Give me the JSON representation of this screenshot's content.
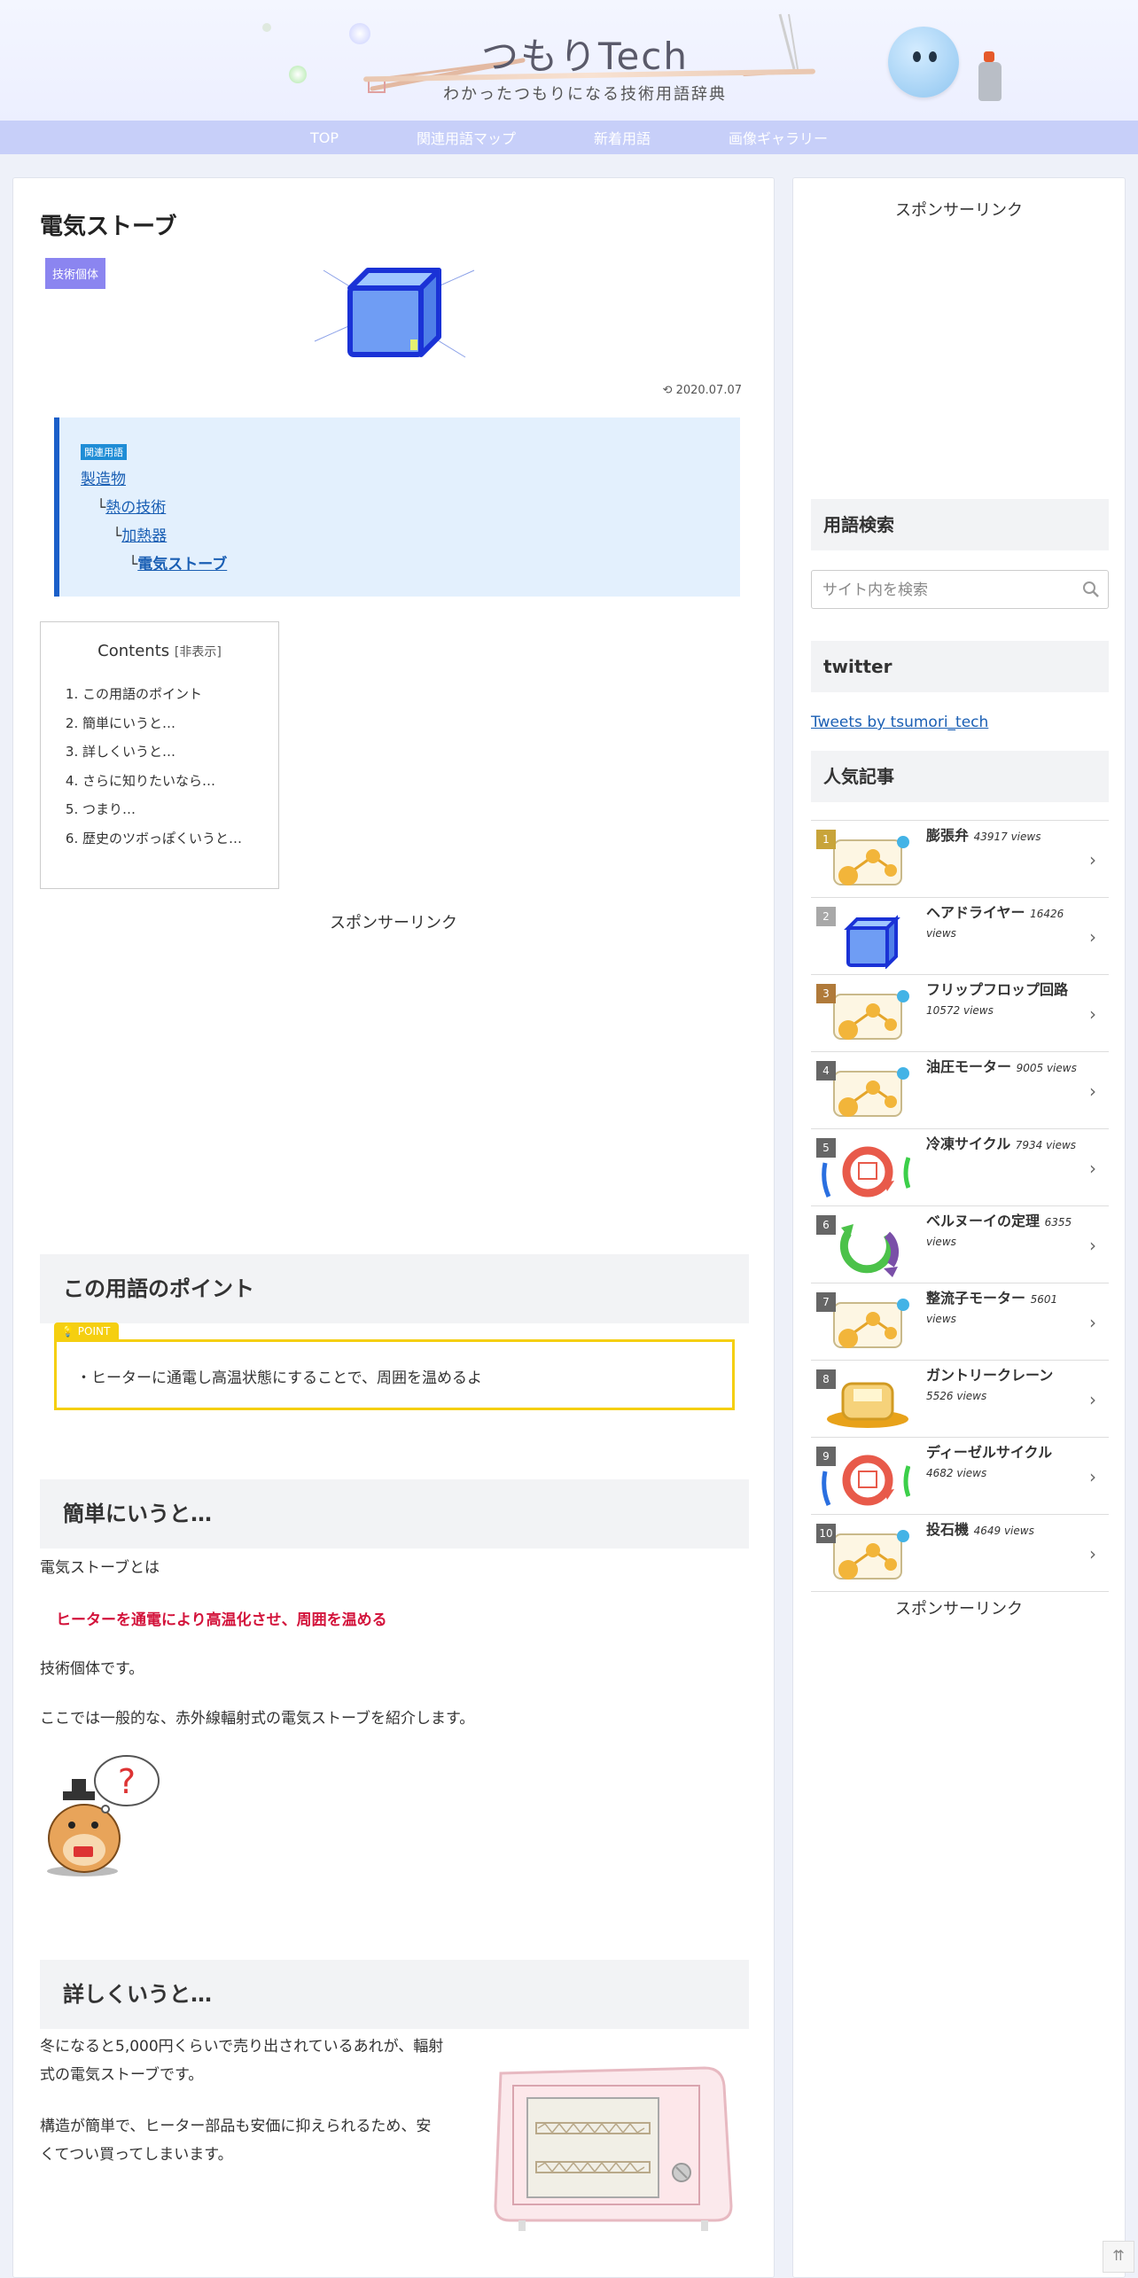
{
  "header": {
    "site_title": "つもりTech",
    "site_subtitle": "わかったつもりになる技術用語辞典"
  },
  "nav": [
    "TOP",
    "関連用語マップ",
    "新着用語",
    "画像ギャラリー"
  ],
  "article": {
    "title": "電気ストーブ",
    "category": "技術個体",
    "date": "2020.07.07",
    "related_label": "関連用語",
    "breadcrumb": [
      {
        "prefix": "",
        "text": "製造物"
      },
      {
        "prefix": "└",
        "text": "熱の技術"
      },
      {
        "prefix": "└",
        "text": "加熱器"
      },
      {
        "prefix": "└",
        "text": "電気ストーブ"
      }
    ],
    "toc": {
      "title": "Contents",
      "toggle": "[非表示]",
      "items": [
        "この用語のポイント",
        "簡単にいうと…",
        "詳しくいうと…",
        "さらに知りたいなら…",
        "つまり…",
        "歴史のツボっぽくいうと…"
      ]
    },
    "sponsor": "スポンサーリンク",
    "section_point": "この用語のポイント",
    "point_label": "POINT",
    "point_text": "・ヒーターに通電し高温状態にすることで、周囲を温めるよ",
    "section_simple": "簡単にいうと…",
    "simple_p1": "電気ストーブとは",
    "simple_marker": "ヒーターを通電により高温化させ、周囲を温める",
    "simple_p2": "技術個体です。",
    "simple_p3": "ここでは一般的な、赤外線輻射式の電気ストーブを紹介します。",
    "section_detail": "詳しくいうと…",
    "detail_p1_l1": "冬になると5,000円くらいで売り出されているあれが、輻射",
    "detail_p1_l2": "式の電気ストーブです。",
    "detail_p2_l1": "構造が簡単で、ヒーター部品も安価に抑えられるため、安",
    "detail_p2_l2": "くてつい買ってしまいます。"
  },
  "sidebar": {
    "sponsor_top": "スポンサーリンク",
    "search_heading": "用語検索",
    "search_placeholder": "サイト内を検索",
    "twitter_heading": "twitter",
    "twitter_link": "Tweets by tsumori_tech",
    "popular_heading": "人気記事",
    "popular": [
      {
        "rank": "1",
        "title": "膨張弁",
        "views": "43917 views",
        "rank_color": "#c8a43a",
        "thumb": "molecule"
      },
      {
        "rank": "2",
        "title": "ヘアドライヤー",
        "views": "16426 views",
        "rank_color": "#a8a8a8",
        "thumb": "cube"
      },
      {
        "rank": "3",
        "title": "フリップフロップ回路",
        "views": "10572 views",
        "rank_color": "#b07a3a",
        "thumb": "molecule"
      },
      {
        "rank": "4",
        "title": "油圧モーター",
        "views": "9005 views",
        "rank_color": "#666666",
        "thumb": "molecule"
      },
      {
        "rank": "5",
        "title": "冷凍サイクル",
        "views": "7934 views",
        "rank_color": "#666666",
        "thumb": "cycle-red"
      },
      {
        "rank": "6",
        "title": "ベルヌーイの定理",
        "views": "6355 views",
        "rank_color": "#666666",
        "thumb": "cycle-green"
      },
      {
        "rank": "7",
        "title": "整流子モーター",
        "views": "5601 views",
        "rank_color": "#666666",
        "thumb": "molecule"
      },
      {
        "rank": "8",
        "title": "ガントリークレーン",
        "views": "5526 views",
        "rank_color": "#666666",
        "thumb": "crane"
      },
      {
        "rank": "9",
        "title": "ディーゼルサイクル",
        "views": "4682 views",
        "rank_color": "#666666",
        "thumb": "cycle-red"
      },
      {
        "rank": "10",
        "title": "投石機",
        "views": "4649 views",
        "rank_color": "#666666",
        "thumb": "molecule"
      }
    ],
    "sponsor_bottom": "スポンサーリンク"
  },
  "colors": {
    "nav_bg": "#c7cff9",
    "category_badge": "#8b85f0",
    "related_border": "#1b5fc9",
    "related_bg": "#e3f0fd",
    "point_border": "#f5cf10",
    "marker_text": "#d3133b"
  },
  "icons": {
    "date": "update-icon",
    "search": "search-icon",
    "go_top": "double-chevron-up-icon"
  }
}
